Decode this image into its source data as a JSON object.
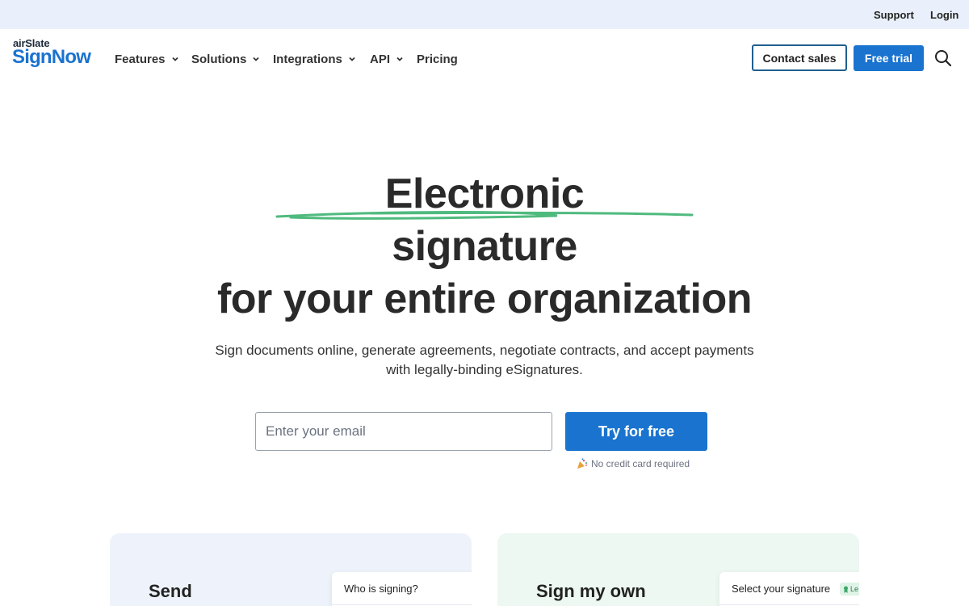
{
  "topbar": {
    "support": "Support",
    "login": "Login"
  },
  "logo": {
    "small": "airSlate",
    "big": "SignNow",
    "brand_color": "#1a73cf"
  },
  "nav": {
    "features": "Features",
    "solutions": "Solutions",
    "integrations": "Integrations",
    "api": "API",
    "pricing": "Pricing"
  },
  "header_actions": {
    "contact_sales": "Contact sales",
    "free_trial": "Free trial"
  },
  "hero": {
    "line1": "Electronic",
    "line2": "signature",
    "line3": "for your entire organization",
    "subtitle": "Sign documents online, generate agreements, negotiate contracts, and accept payments with legally-binding eSignatures.",
    "underline_color": "#4fba7e"
  },
  "signup": {
    "email_placeholder": "Enter your email",
    "email_value": "",
    "cta": "Try for free",
    "note": "No credit card required"
  },
  "cards": [
    {
      "title": "Send",
      "panel_title": "Who is signing?"
    },
    {
      "title": "Sign my own",
      "panel_title": "Select your signature",
      "badge": "Le"
    }
  ]
}
